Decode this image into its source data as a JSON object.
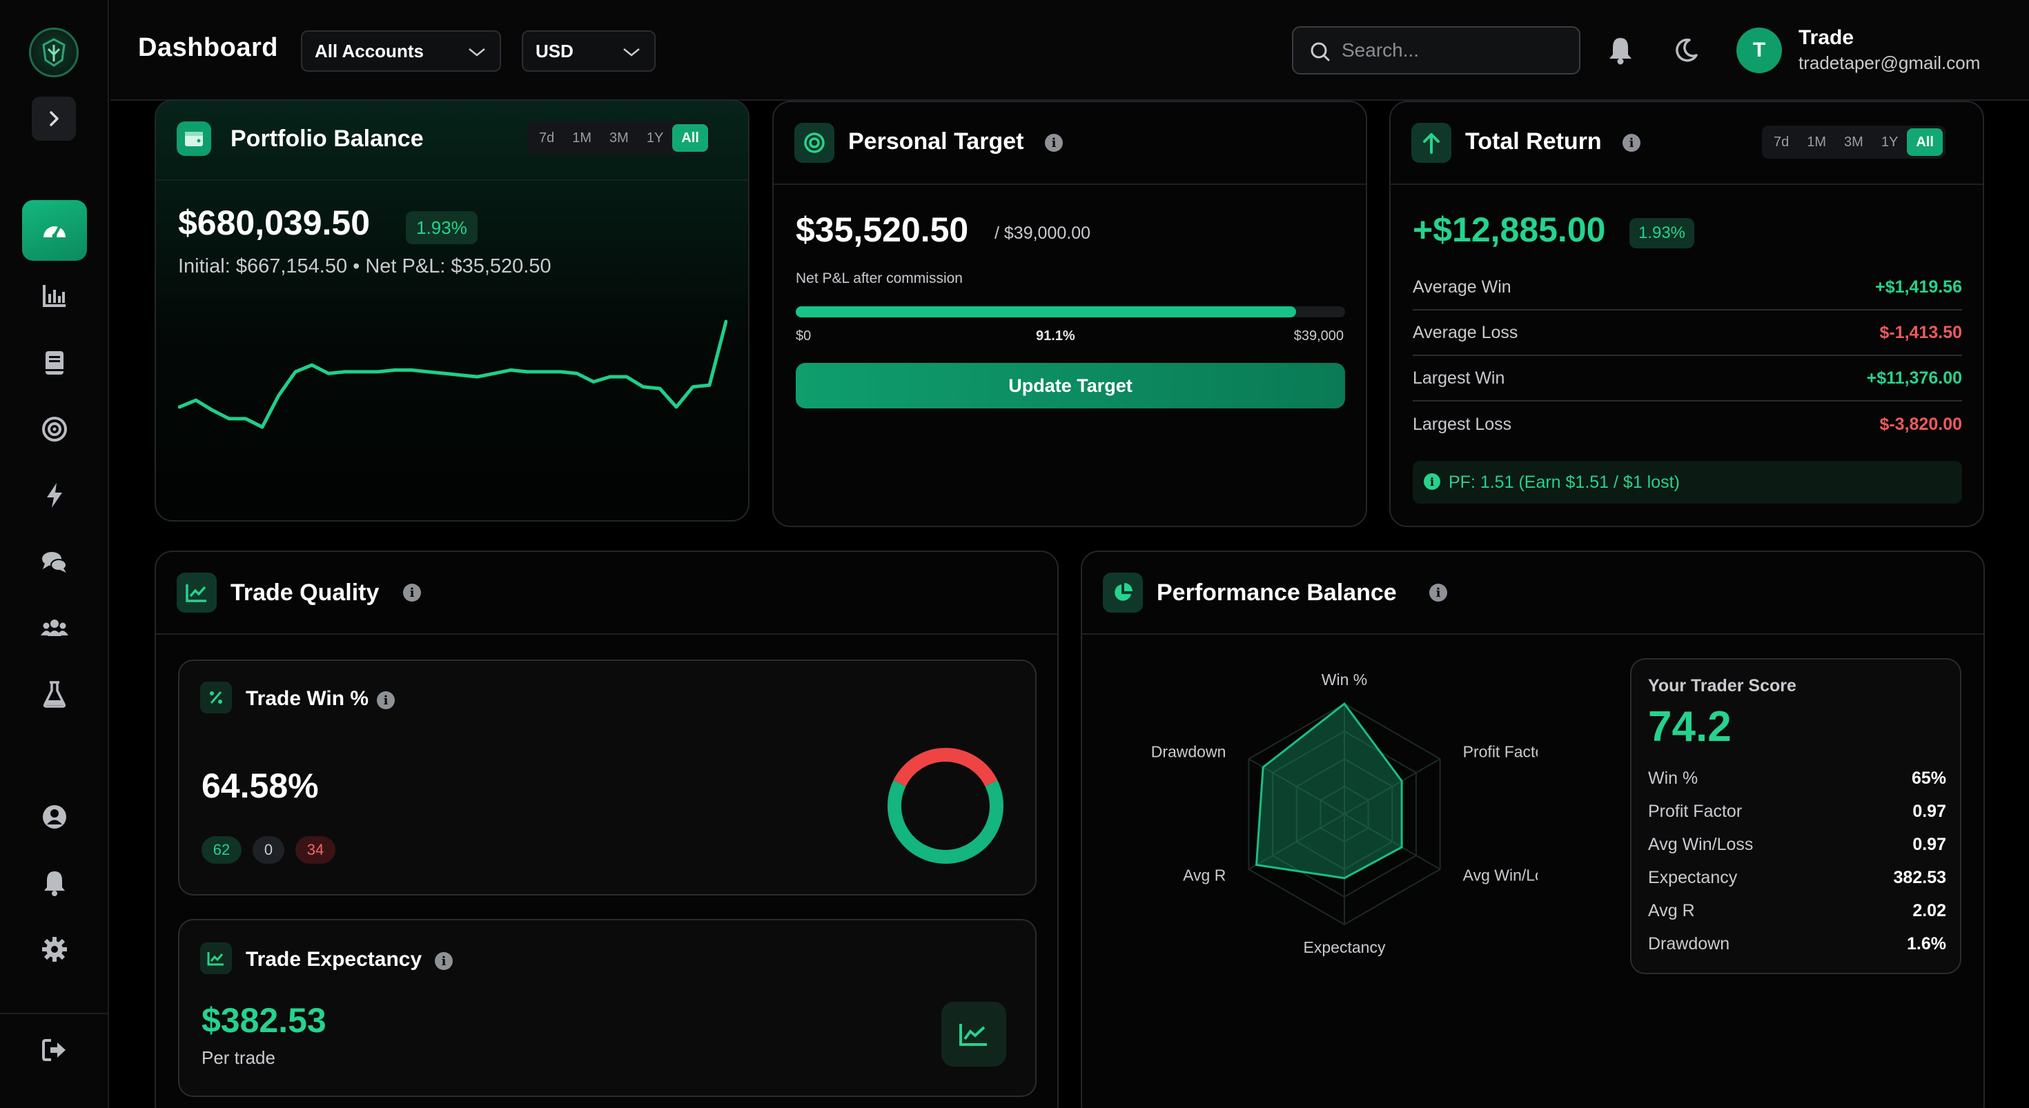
{
  "header": {
    "title": "Dashboard",
    "account_select": "All Accounts",
    "currency_select": "USD",
    "search_placeholder": "Search...",
    "user": {
      "initial": "T",
      "name": "Trade",
      "email": "tradetaper@gmail.com"
    }
  },
  "sidebar": {
    "items": [
      "dashboard-icon",
      "analytics-icon",
      "journal-icon",
      "target-icon",
      "bolt-icon",
      "chat-icon",
      "community-icon",
      "lab-icon",
      "profile-icon",
      "notifications-icon",
      "settings-icon",
      "logout-icon"
    ],
    "active": "dashboard-icon"
  },
  "ranges": [
    "7d",
    "1M",
    "3M",
    "1Y",
    "All"
  ],
  "portfolio": {
    "title": "Portfolio Balance",
    "balance": "$680,039.50",
    "change": "1.93%",
    "subtitle": "Initial: $667,154.50 • Net P&L: $35,520.50",
    "active_range": "All",
    "sparkline": [
      51,
      47,
      53,
      58,
      58,
      63,
      44,
      30,
      26,
      31,
      30,
      30,
      30,
      29,
      29,
      30,
      31,
      32,
      33,
      31,
      29,
      30,
      30,
      30,
      31,
      36,
      33,
      33,
      39,
      40,
      51,
      39,
      38,
      0
    ]
  },
  "target": {
    "title": "Personal Target",
    "current": "$35,520.50",
    "goal": "/ $39,000.00",
    "caption": "Net P&L after commission",
    "progress": 91.1,
    "min_label": "$0",
    "pct_label": "91.1%",
    "max_label": "$39,000",
    "button": "Update Target"
  },
  "total_return": {
    "title": "Total Return",
    "value": "+$12,885.00",
    "change": "1.93%",
    "active_range": "All",
    "rows": [
      {
        "label": "Average Win",
        "value": "+$1,419.56",
        "positive": true
      },
      {
        "label": "Average Loss",
        "value": "$-1,413.50",
        "positive": false
      },
      {
        "label": "Largest Win",
        "value": "+$11,376.00",
        "positive": true
      },
      {
        "label": "Largest Loss",
        "value": "$-3,820.00",
        "positive": false
      }
    ],
    "pf_note": "PF: 1.51 (Earn $1.51 / $1 lost)"
  },
  "trade_quality": {
    "title": "Trade Quality",
    "win": {
      "title": "Trade Win %",
      "value": "64.58%",
      "wins": "62",
      "breakeven": "0",
      "losses": "34",
      "win_fraction": 0.6458
    },
    "expectancy": {
      "title": "Trade Expectancy",
      "value": "$382.53",
      "caption": "Per trade"
    }
  },
  "performance": {
    "title": "Performance Balance",
    "radar_axes": [
      "Win %",
      "Profit Factor",
      "Avg Win/Loss",
      "Expectancy",
      "Avg R",
      "Drawdown"
    ],
    "radar_values": [
      1.0,
      0.6,
      0.6,
      0.58,
      0.92,
      0.85
    ],
    "score_title": "Your Trader Score",
    "score": "74.2",
    "metrics": [
      {
        "label": "Win %",
        "value": "65%"
      },
      {
        "label": "Profit Factor",
        "value": "0.97"
      },
      {
        "label": "Avg Win/Loss",
        "value": "0.97"
      },
      {
        "label": "Expectancy",
        "value": "382.53"
      },
      {
        "label": "Avg R",
        "value": "2.02"
      },
      {
        "label": "Drawdown",
        "value": "1.6%"
      }
    ]
  },
  "colors": {
    "accent": "#12a874",
    "positive": "#25d38e",
    "negative": "#ef5a5a",
    "loss_ring": "#ef4444"
  }
}
